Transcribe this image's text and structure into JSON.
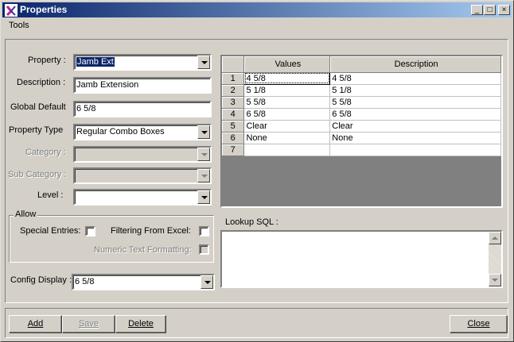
{
  "window": {
    "title": "Properties",
    "minimize": "_",
    "maximize": "□",
    "close": "×"
  },
  "menu": {
    "tools": "Tools"
  },
  "form": {
    "property_label": "Property :",
    "property_value": "Jamb Ext",
    "description_label": "Description :",
    "description_value": "Jamb Extension",
    "global_default_label": "Global Default",
    "global_default_value": "6 5/8",
    "property_type_label": "Property Type",
    "property_type_value": "Regular Combo Boxes",
    "category_label": "Category :",
    "category_value": "",
    "sub_category_label": "Sub Category :",
    "sub_category_value": "",
    "level_label": "Level :",
    "level_value": ""
  },
  "allow": {
    "legend": "Allow",
    "special_entries": "Special Entries:",
    "special_entries_checked": false,
    "filtering_from_excel": "Filtering From Excel:",
    "filtering_from_excel_checked": false,
    "numeric_text_formatting": "Numeric Text Formatting:",
    "numeric_text_formatting_checked": false
  },
  "config_display": {
    "label": "Config Display :",
    "value": "6 5/8"
  },
  "grid": {
    "columns": [
      "Values",
      "Description"
    ],
    "rows": [
      {
        "num": "1",
        "value": "4 5/8",
        "description": "4 5/8"
      },
      {
        "num": "2",
        "value": "5 1/8",
        "description": "5 1/8"
      },
      {
        "num": "3",
        "value": "5 5/8",
        "description": "5 5/8"
      },
      {
        "num": "4",
        "value": "6 5/8",
        "description": "6 5/8"
      },
      {
        "num": "5",
        "value": "Clear",
        "description": "Clear"
      },
      {
        "num": "6",
        "value": "None",
        "description": "None"
      },
      {
        "num": "7",
        "value": "",
        "description": ""
      }
    ]
  },
  "lookup_sql": {
    "label": "Lookup SQL :",
    "value": ""
  },
  "buttons": {
    "add": "Add",
    "save": "Save",
    "delete": "Delete",
    "close": "Close"
  }
}
